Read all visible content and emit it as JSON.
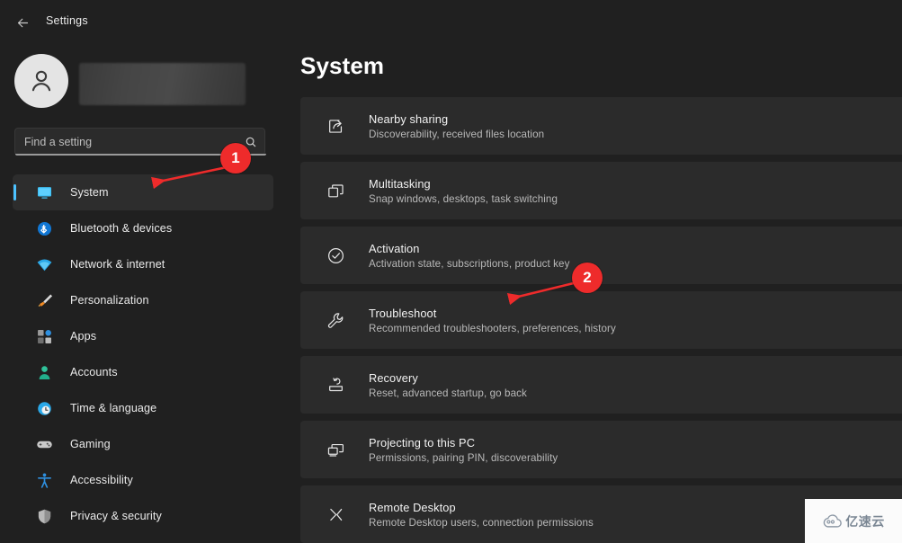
{
  "window": {
    "title": "Settings",
    "back_icon": "back-arrow-icon"
  },
  "account": {
    "avatar_icon": "user-avatar-icon",
    "name_redacted": true
  },
  "search": {
    "placeholder": "Find a setting",
    "value": "",
    "icon": "search-icon"
  },
  "sidebar": {
    "items": [
      {
        "label": "System",
        "icon": "monitor-icon",
        "active": true
      },
      {
        "label": "Bluetooth & devices",
        "icon": "bluetooth-icon",
        "active": false
      },
      {
        "label": "Network & internet",
        "icon": "wifi-icon",
        "active": false
      },
      {
        "label": "Personalization",
        "icon": "paintbrush-icon",
        "active": false
      },
      {
        "label": "Apps",
        "icon": "apps-grid-icon",
        "active": false
      },
      {
        "label": "Accounts",
        "icon": "person-icon",
        "active": false
      },
      {
        "label": "Time & language",
        "icon": "clock-globe-icon",
        "active": false
      },
      {
        "label": "Gaming",
        "icon": "gamepad-icon",
        "active": false
      },
      {
        "label": "Accessibility",
        "icon": "accessibility-icon",
        "active": false
      },
      {
        "label": "Privacy & security",
        "icon": "shield-icon",
        "active": false
      }
    ]
  },
  "main": {
    "title": "System",
    "rows": [
      {
        "title": "Nearby sharing",
        "subtitle": "Discoverability, received files location",
        "icon": "share-icon"
      },
      {
        "title": "Multitasking",
        "subtitle": "Snap windows, desktops, task switching",
        "icon": "windows-stack-icon"
      },
      {
        "title": "Activation",
        "subtitle": "Activation state, subscriptions, product key",
        "icon": "checkmark-circle-icon"
      },
      {
        "title": "Troubleshoot",
        "subtitle": "Recommended troubleshooters, preferences, history",
        "icon": "wrench-icon"
      },
      {
        "title": "Recovery",
        "subtitle": "Reset, advanced startup, go back",
        "icon": "recovery-arrow-icon"
      },
      {
        "title": "Projecting to this PC",
        "subtitle": "Permissions, pairing PIN, discoverability",
        "icon": "projector-screens-icon"
      },
      {
        "title": "Remote Desktop",
        "subtitle": "Remote Desktop users, connection permissions",
        "icon": "remote-desktop-icon"
      }
    ]
  },
  "annotations": {
    "accent_color": "#ee2b2b",
    "markers": [
      {
        "number": "1",
        "target": "sidebar-item-system"
      },
      {
        "number": "2",
        "target": "main-row-troubleshoot"
      }
    ]
  },
  "watermark": {
    "text": "亿速云",
    "icon": "cloud-logo-icon"
  },
  "colors": {
    "app_background": "#202020",
    "card_background": "#2b2b2b",
    "sidebar_active": "#2d2d2d",
    "accent_blue": "#4cc2ff",
    "annotation_red": "#ee2b2b"
  }
}
